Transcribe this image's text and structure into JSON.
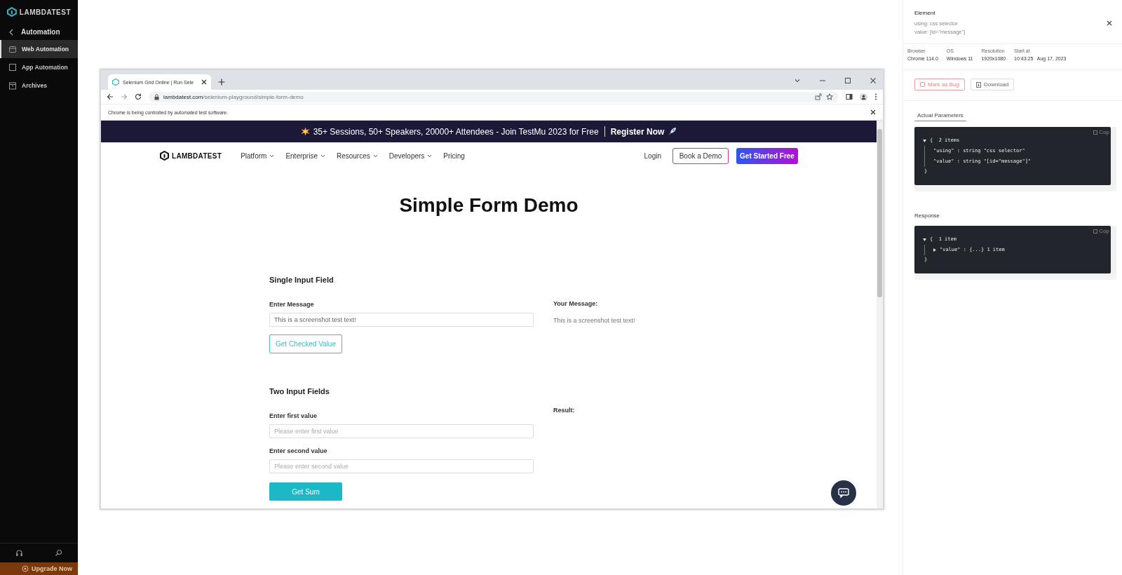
{
  "sidebar": {
    "logo": "LAMBDATEST",
    "back": "Automation",
    "items": [
      {
        "label": "Web Automation",
        "kind": "web",
        "selected": true
      },
      {
        "label": "App Automation",
        "kind": "app",
        "selected": false
      },
      {
        "label": "Archives",
        "kind": "archive",
        "selected": false
      }
    ],
    "upgrade": "Upgrade Now"
  },
  "browser": {
    "tab_title": "Selenium Grid Online | Run Sele",
    "url_host": "lambdatest.com",
    "url_path": "/selenium-playground/simple-form-demo",
    "infobar": "Chrome is being controlled by automated test software.",
    "page": {
      "banner": {
        "text": "35+ Sessions, 50+ Speakers, 20000+ Attendees - Join TestMu 2023 for Free",
        "cta": "Register Now"
      },
      "nav": {
        "logo": "LAMBDATEST",
        "menu": [
          {
            "label": "Platform",
            "dropdown": true
          },
          {
            "label": "Enterprise",
            "dropdown": true
          },
          {
            "label": "Resources",
            "dropdown": true
          },
          {
            "label": "Developers",
            "dropdown": true
          },
          {
            "label": "Pricing",
            "dropdown": false
          }
        ],
        "login": "Login",
        "book_demo": "Book a Demo",
        "get_started": "Get Started Free"
      },
      "title": "Simple Form Demo",
      "single": {
        "heading": "Single Input Field",
        "label": "Enter Message",
        "value": "This is a screenshot test text!",
        "button": "Get Checked Value",
        "result_label": "Your Message:",
        "result": "This is a screenshot test text!"
      },
      "two": {
        "heading": "Two Input Fields",
        "first_label": "Enter first value",
        "first_placeholder": "Please enter first value",
        "second_label": "Enter second value",
        "second_placeholder": "Please enter second value",
        "button": "Get Sum",
        "result_label": "Result:"
      }
    }
  },
  "panel": {
    "title": "Element",
    "using": "using: css selector",
    "value": "value: [id=\"message\"]",
    "info": [
      {
        "label": "Browser",
        "value": "Chrome 114.0"
      },
      {
        "label": "OS",
        "value": "Windows 11"
      },
      {
        "label": "Resolution",
        "value": "1920x1080"
      },
      {
        "label": "Start at",
        "value": "10:43:25   Aug 17, 2023"
      }
    ],
    "mark_bug": "Mark as Bug",
    "download": "Download",
    "params_tab": "Actual Parameters",
    "params": {
      "copy": "Cop",
      "summary": "{  2 items",
      "lines": [
        {
          "text": "\"using\" : string \"css selector\"",
          "expandable": false
        },
        {
          "text": "\"value\" : string \"[id=\"message\"]\"",
          "expandable": false
        }
      ],
      "close": "}"
    },
    "response_label": "Response",
    "response": {
      "copy": "Cop",
      "summary": "{  1 item",
      "lines": [
        {
          "text": "\"value\" : {...} 1 item",
          "expandable": true
        }
      ],
      "close": "}"
    }
  }
}
